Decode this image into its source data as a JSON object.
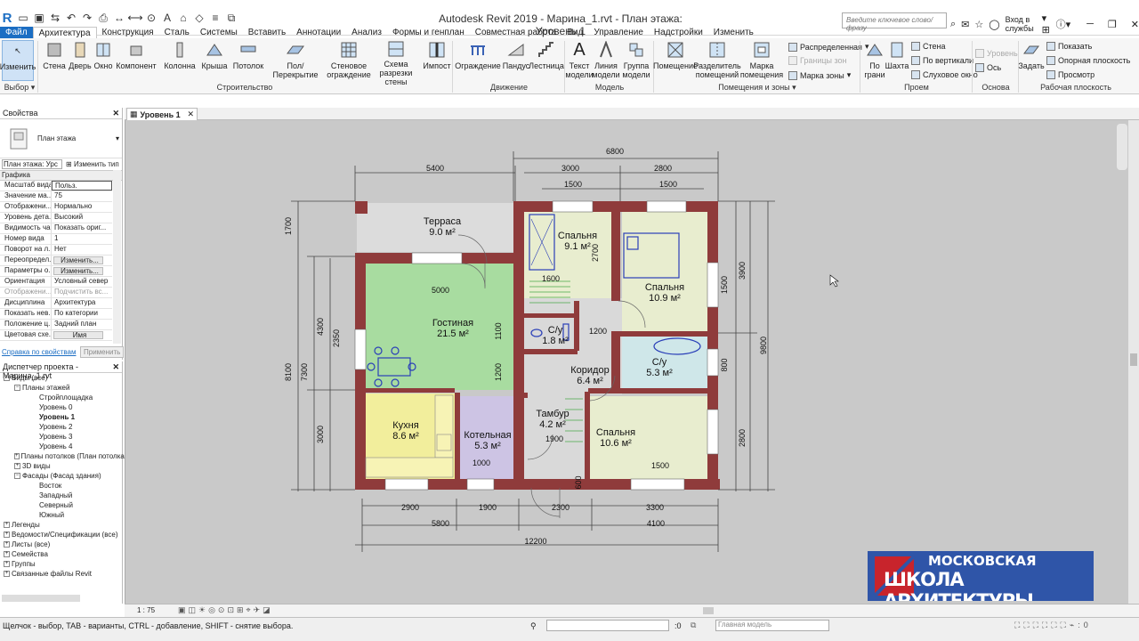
{
  "window": {
    "title": "Autodesk Revit 2019 - Марина_1.rvt - План этажа: Уровень 1",
    "search_placeholder": "Введите ключевое слово/фразу",
    "signin": "Вход в службы"
  },
  "ribbon": {
    "tabs": [
      "Файл",
      "Архитектура",
      "Конструкция",
      "Сталь",
      "Системы",
      "Вставить",
      "Аннотации",
      "Анализ",
      "Формы и генплан",
      "Совместная работа",
      "Вид",
      "Управление",
      "Надстройки",
      "Изменить"
    ],
    "active_tab": "Архитектура",
    "buttons": {
      "modify": "Изменить",
      "wall": "Стена",
      "door": "Дверь",
      "window": "Окно",
      "component": "Компонент",
      "column": "Колонна",
      "roof": "Крыша",
      "ceiling": "Потолок",
      "floor": "Пол/Перекрытие",
      "curtain_system": "Стеновое ограждение",
      "curtain_grid": "Схема разрезки стены",
      "mullion": "Импост",
      "railing": "Ограждение",
      "ramp": "Пандус",
      "stair": "Лестница",
      "model_text": "Текст модели",
      "model_line": "Линия модели",
      "model_group": "Группа модели",
      "room": "Помещение",
      "room_separator": "Разделитель помещений",
      "room_tag": "Марка помещения",
      "by_face": "По грани",
      "shaft": "Шахта",
      "set": "Задать"
    },
    "small": {
      "area": "Распределенная",
      "area_boundary": "Границы зон",
      "area_tag": "Марка зоны",
      "opening_wall": "Стена",
      "opening_vertical": "По вертикали",
      "dormer": "Слуховое окно",
      "level": "Уровень",
      "grid": "Ось",
      "show": "Показать",
      "ref_plane": "Опорная плоскость",
      "viewer": "Просмотр"
    },
    "groups": {
      "select": "Выбор",
      "build": "Строительство",
      "circulation": "Движение",
      "model": "Модель",
      "room_area": "Помещения и зоны",
      "opening": "Проем",
      "datum": "Основа",
      "work_plane": "Рабочая плоскость"
    }
  },
  "properties": {
    "title": "Свойства",
    "type_name": "План этажа",
    "selector": "План этажа: Урс",
    "edit_type": "Изменить тип",
    "section": "Графика",
    "rows": [
      {
        "k": "Масштаб вида",
        "v": "Польз."
      },
      {
        "k": "Значение ма...",
        "v": "75"
      },
      {
        "k": "Отображени...",
        "v": "Нормально"
      },
      {
        "k": "Уровень дета...",
        "v": "Высокий"
      },
      {
        "k": "Видимость ча...",
        "v": "Показать ориг..."
      },
      {
        "k": "Номер вида",
        "v": "1"
      },
      {
        "k": "Поворот на л...",
        "v": "Нет"
      },
      {
        "k": "Переопредел...",
        "v": "Изменить..."
      },
      {
        "k": "Параметры о...",
        "v": "Изменить..."
      },
      {
        "k": "Ориентация",
        "v": "Условный север"
      },
      {
        "k": "Отображени...",
        "v": "Подчистить вс..."
      },
      {
        "k": "Дисциплина",
        "v": "Архитектура"
      },
      {
        "k": "Показать нев...",
        "v": "По категории"
      },
      {
        "k": "Положение ц...",
        "v": "Задний план"
      },
      {
        "k": "Цветовая схе...",
        "v": "Имя"
      }
    ],
    "help": "Справка по свойствам",
    "apply": "Применить"
  },
  "browser": {
    "title": "Диспетчер проекта - Марина_1.rvt",
    "items": [
      {
        "t": "Виды (все)",
        "lvl": 0
      },
      {
        "t": "Планы этажей",
        "lvl": 1
      },
      {
        "t": "Стройплощадка",
        "lvl": 2
      },
      {
        "t": "Уровень 0",
        "lvl": 2
      },
      {
        "t": "Уровень 1",
        "lvl": 2,
        "bold": true
      },
      {
        "t": "Уровень 2",
        "lvl": 2
      },
      {
        "t": "Уровень 3",
        "lvl": 2
      },
      {
        "t": "Уровень 4",
        "lvl": 2
      },
      {
        "t": "Планы потолков (План потолка)",
        "lvl": 1
      },
      {
        "t": "3D виды",
        "lvl": 1
      },
      {
        "t": "Фасады (Фасад здания)",
        "lvl": 1
      },
      {
        "t": "Восток",
        "lvl": 2
      },
      {
        "t": "Западный",
        "lvl": 2
      },
      {
        "t": "Северный",
        "lvl": 2
      },
      {
        "t": "Южный",
        "lvl": 2
      },
      {
        "t": "Легенды",
        "lvl": 0
      },
      {
        "t": "Ведомости/Спецификации (все)",
        "lvl": 0
      },
      {
        "t": "Листы (все)",
        "lvl": 0
      },
      {
        "t": "Семейства",
        "lvl": 0
      },
      {
        "t": "Группы",
        "lvl": 0
      },
      {
        "t": "Связанные файлы Revit",
        "lvl": 0
      }
    ]
  },
  "view": {
    "tab": "Уровень 1",
    "scale": "1 : 75"
  },
  "plan": {
    "rooms": [
      {
        "name": "Терраса",
        "area": "9.0 м²"
      },
      {
        "name": "Гостиная",
        "area": "21.5 м²"
      },
      {
        "name": "Кухня",
        "area": "8.6 м²"
      },
      {
        "name": "Котельная",
        "area": "5.3 м²"
      },
      {
        "name": "Спальня",
        "area": "9.1 м²"
      },
      {
        "name": "Спальня",
        "area": "10.9 м²"
      },
      {
        "name": "С/у",
        "area": "1.8 м²"
      },
      {
        "name": "С/у",
        "area": "5.3 м²"
      },
      {
        "name": "Коридор",
        "area": "6.4 м²"
      },
      {
        "name": "Тамбур",
        "area": "4.2 м²"
      },
      {
        "name": "Спальня",
        "area": "10.6 м²"
      }
    ],
    "dims": {
      "top_total": "6800",
      "top_left": "5400",
      "top_a": "3000",
      "top_b": "2800",
      "top_a1": "1500",
      "top_b1": "1500",
      "bot_a": "2900",
      "bot_b": "1900",
      "bot_c": "2300",
      "bot_d": "3300",
      "bot_e": "5800",
      "bot_f": "4100",
      "bot_total": "12200",
      "left_a": "1700",
      "left_b": "4300",
      "left_c": "2350",
      "left_d": "7300",
      "left_e": "8100",
      "left_f": "3000",
      "right_a": "3900",
      "right_b": "1500",
      "right_c": "800",
      "right_d": "2800",
      "right_total": "9800",
      "in_5000": "5000",
      "in_1600": "1600",
      "in_2700": "2700",
      "in_1100": "1100",
      "in_1200a": "1200",
      "in_1200b": "1200",
      "in_1900": "1900",
      "in_1000": "1000",
      "in_1500": "1500",
      "in_600": "600"
    }
  },
  "logo": {
    "line1": "МОСКОВСКАЯ",
    "line2": "ШКОЛА АРХИТЕКТУРЫ"
  },
  "status": {
    "hint": "Щелчок - выбор, TAB - варианты, CTRL - добавление, SHIFT - снятие выбора.",
    "coord": ":0",
    "model": "Главная модель"
  },
  "colors": {
    "accent": "#1c6ec3",
    "wall": "#8f3b3b",
    "living": "#a8dca0",
    "kitchen": "#f2ee9c",
    "boiler": "#cdc4e4",
    "bed": "#e8edcf",
    "bath": "#cfe7e9",
    "hall": "#d9d9d9",
    "terrace": "#dddddd"
  }
}
